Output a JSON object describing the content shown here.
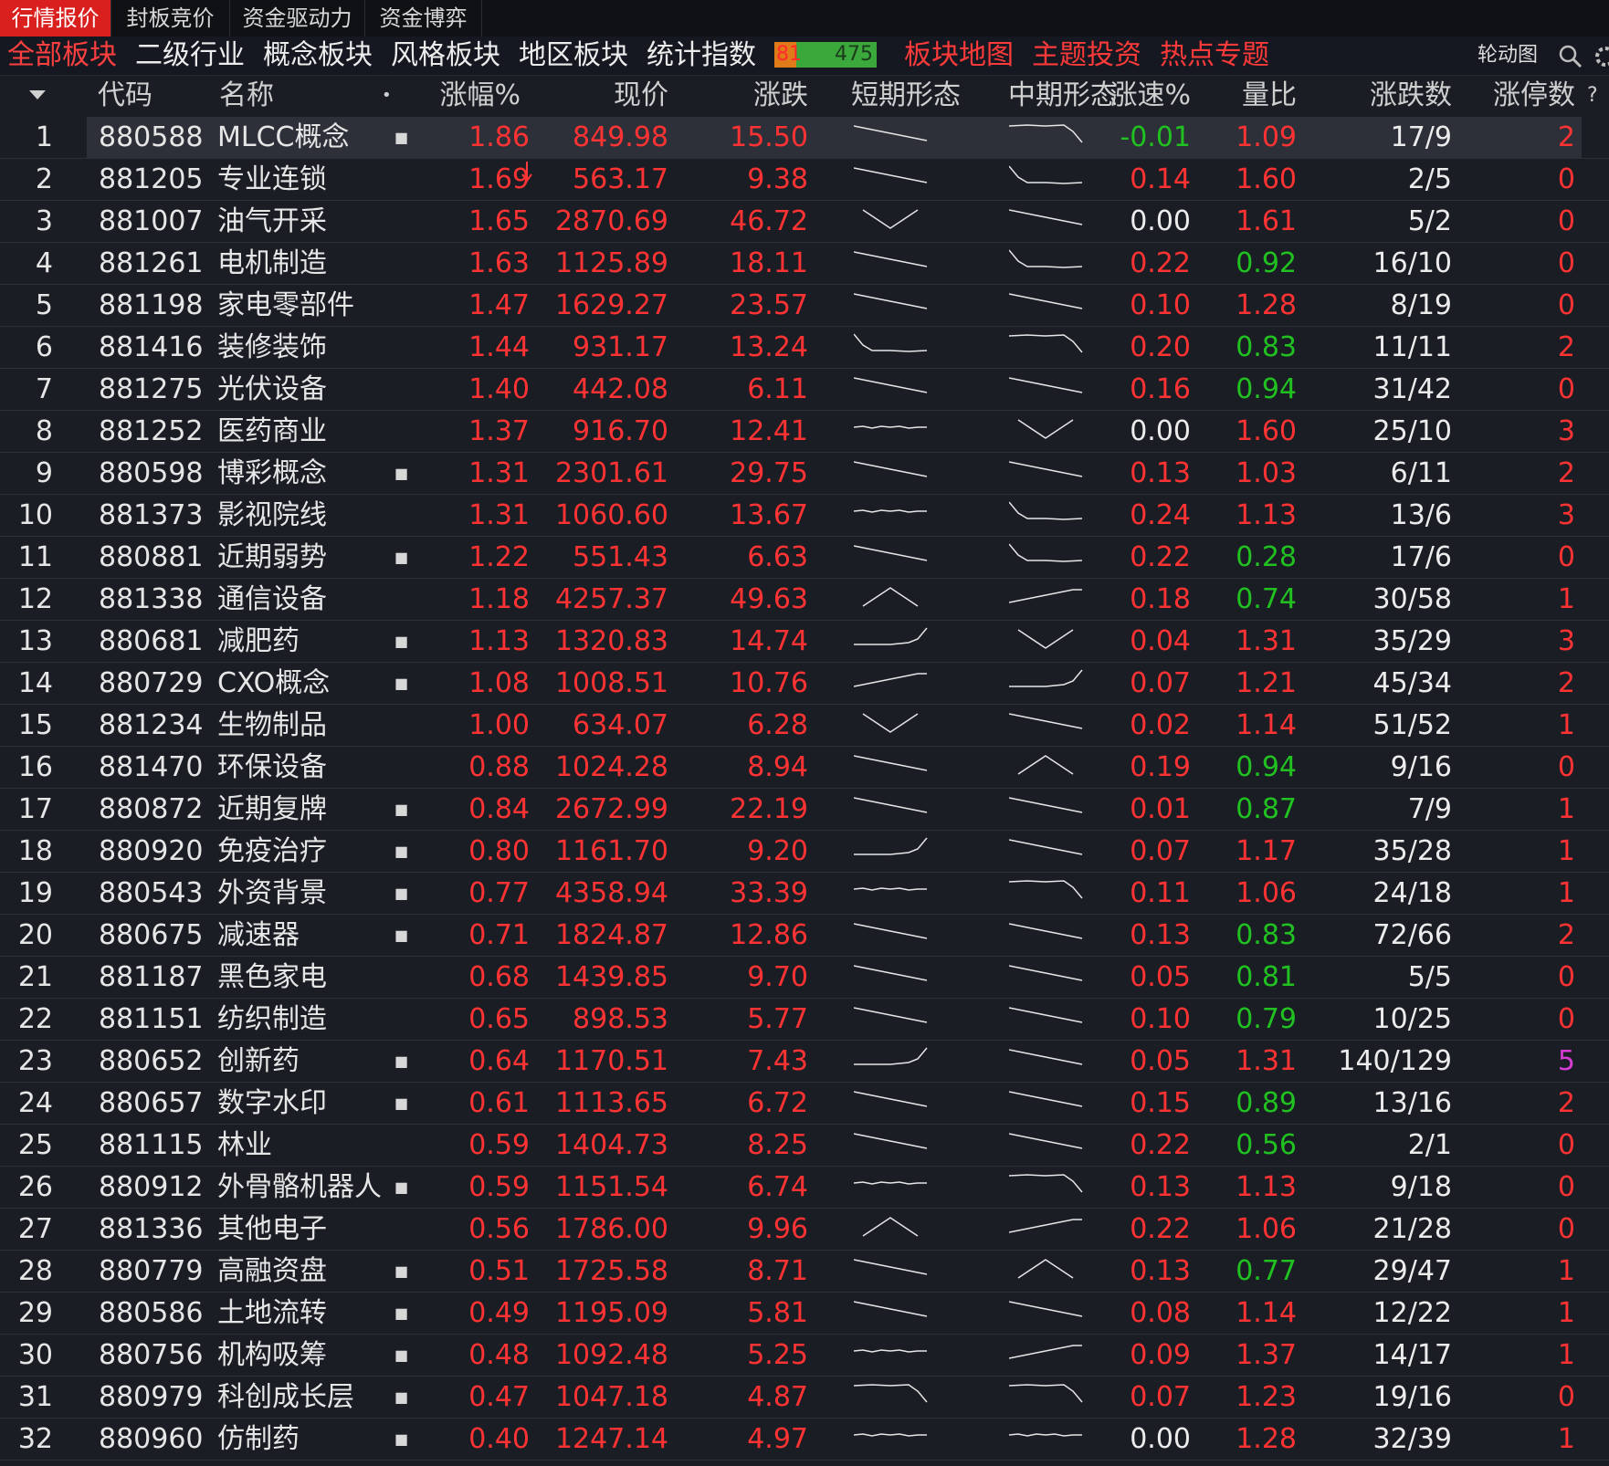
{
  "top_tabs": [
    "行情报价",
    "封板竞价",
    "资金驱动力",
    "资金博弈"
  ],
  "categories": [
    "全部板块",
    "二级行业",
    "概念板块",
    "风格板块",
    "地区板块",
    "统计指数"
  ],
  "ratio": {
    "up": "81",
    "down": "475"
  },
  "feature_links": [
    "板块地图",
    "主题投资",
    "热点专题"
  ],
  "rotation_label": "轮动图",
  "help_label": "?",
  "columns": {
    "code": "代码",
    "name": "名称",
    "dot": "•",
    "change_pct": "涨幅%",
    "price": "现价",
    "change": "涨跌",
    "short": "短期形态",
    "mid": "中期形态",
    "speed": "涨速%",
    "vol_ratio": "量比",
    "updown": "涨跌数",
    "limit_up": "涨停数"
  },
  "colors": {
    "red": "#ff3333",
    "green": "#21c121",
    "white": "#ececec",
    "purple": "#d63bd6",
    "active_tab": "#d9201e"
  },
  "rows": [
    {
      "idx": "1",
      "code": "880588",
      "name": "MLCC概念",
      "dot": true,
      "pct": "1.86",
      "price": "849.98",
      "chg": "15.50",
      "short": "down",
      "mid": "flatdrop",
      "speed": "-0.01",
      "speed_c": "green",
      "vr": "1.09",
      "vr_c": "red",
      "ud": "17/9",
      "lu": "2",
      "lu_c": "red"
    },
    {
      "idx": "2",
      "code": "881205",
      "name": "专业连锁",
      "dot": false,
      "pct": "1.69",
      "price": "563.17",
      "chg": "9.38",
      "short": "down",
      "mid": "dropflat",
      "speed": "0.14",
      "speed_c": "red",
      "vr": "1.60",
      "vr_c": "red",
      "ud": "2/5",
      "lu": "0",
      "lu_c": "red"
    },
    {
      "idx": "3",
      "code": "881007",
      "name": "油气开采",
      "dot": false,
      "pct": "1.65",
      "price": "2870.69",
      "chg": "46.72",
      "short": "v",
      "mid": "down",
      "speed": "0.00",
      "speed_c": "white",
      "vr": "1.61",
      "vr_c": "red",
      "ud": "5/2",
      "lu": "0",
      "lu_c": "red"
    },
    {
      "idx": "4",
      "code": "881261",
      "name": "电机制造",
      "dot": false,
      "pct": "1.63",
      "price": "1125.89",
      "chg": "18.11",
      "short": "down",
      "mid": "dropflat",
      "speed": "0.22",
      "speed_c": "red",
      "vr": "0.92",
      "vr_c": "green",
      "ud": "16/10",
      "lu": "0",
      "lu_c": "red"
    },
    {
      "idx": "5",
      "code": "881198",
      "name": "家电零部件",
      "dot": false,
      "pct": "1.47",
      "price": "1629.27",
      "chg": "23.57",
      "short": "down",
      "mid": "down",
      "speed": "0.10",
      "speed_c": "red",
      "vr": "1.28",
      "vr_c": "red",
      "ud": "8/19",
      "lu": "0",
      "lu_c": "red"
    },
    {
      "idx": "6",
      "code": "881416",
      "name": "装修装饰",
      "dot": false,
      "pct": "1.44",
      "price": "931.17",
      "chg": "13.24",
      "short": "dropflat",
      "mid": "flatdrop",
      "speed": "0.20",
      "speed_c": "red",
      "vr": "0.83",
      "vr_c": "green",
      "ud": "11/11",
      "lu": "2",
      "lu_c": "red"
    },
    {
      "idx": "7",
      "code": "881275",
      "name": "光伏设备",
      "dot": false,
      "pct": "1.40",
      "price": "442.08",
      "chg": "6.11",
      "short": "down",
      "mid": "down",
      "speed": "0.16",
      "speed_c": "red",
      "vr": "0.94",
      "vr_c": "green",
      "ud": "31/42",
      "lu": "0",
      "lu_c": "red"
    },
    {
      "idx": "8",
      "code": "881252",
      "name": "医药商业",
      "dot": false,
      "pct": "1.37",
      "price": "916.70",
      "chg": "12.41",
      "short": "flat",
      "mid": "v",
      "speed": "0.00",
      "speed_c": "white",
      "vr": "1.60",
      "vr_c": "red",
      "ud": "25/10",
      "lu": "3",
      "lu_c": "red"
    },
    {
      "idx": "9",
      "code": "880598",
      "name": "博彩概念",
      "dot": true,
      "pct": "1.31",
      "price": "2301.61",
      "chg": "29.75",
      "short": "down",
      "mid": "down",
      "speed": "0.13",
      "speed_c": "red",
      "vr": "1.03",
      "vr_c": "red",
      "ud": "6/11",
      "lu": "2",
      "lu_c": "red"
    },
    {
      "idx": "10",
      "code": "881373",
      "name": "影视院线",
      "dot": false,
      "pct": "1.31",
      "price": "1060.60",
      "chg": "13.67",
      "short": "flat",
      "mid": "dropflat",
      "speed": "0.24",
      "speed_c": "red",
      "vr": "1.13",
      "vr_c": "red",
      "ud": "13/6",
      "lu": "3",
      "lu_c": "red"
    },
    {
      "idx": "11",
      "code": "880881",
      "name": "近期弱势",
      "dot": true,
      "pct": "1.22",
      "price": "551.43",
      "chg": "6.63",
      "short": "down",
      "mid": "dropflat",
      "speed": "0.22",
      "speed_c": "red",
      "vr": "0.28",
      "vr_c": "green",
      "ud": "17/6",
      "lu": "0",
      "lu_c": "red"
    },
    {
      "idx": "12",
      "code": "881338",
      "name": "通信设备",
      "dot": false,
      "pct": "1.18",
      "price": "4257.37",
      "chg": "49.63",
      "short": "peak",
      "mid": "up",
      "speed": "0.18",
      "speed_c": "red",
      "vr": "0.74",
      "vr_c": "green",
      "ud": "30/58",
      "lu": "1",
      "lu_c": "red"
    },
    {
      "idx": "13",
      "code": "880681",
      "name": "减肥药",
      "dot": true,
      "pct": "1.13",
      "price": "1320.83",
      "chg": "14.74",
      "short": "flatrise",
      "mid": "v",
      "speed": "0.04",
      "speed_c": "red",
      "vr": "1.31",
      "vr_c": "red",
      "ud": "35/29",
      "lu": "3",
      "lu_c": "red"
    },
    {
      "idx": "14",
      "code": "880729",
      "name": "CXO概念",
      "dot": true,
      "pct": "1.08",
      "price": "1008.51",
      "chg": "10.76",
      "short": "up",
      "mid": "flatrise",
      "speed": "0.07",
      "speed_c": "red",
      "vr": "1.21",
      "vr_c": "red",
      "ud": "45/34",
      "lu": "2",
      "lu_c": "red"
    },
    {
      "idx": "15",
      "code": "881234",
      "name": "生物制品",
      "dot": false,
      "pct": "1.00",
      "price": "634.07",
      "chg": "6.28",
      "short": "v",
      "mid": "down",
      "speed": "0.02",
      "speed_c": "red",
      "vr": "1.14",
      "vr_c": "red",
      "ud": "51/52",
      "lu": "1",
      "lu_c": "red"
    },
    {
      "idx": "16",
      "code": "881470",
      "name": "环保设备",
      "dot": false,
      "pct": "0.88",
      "price": "1024.28",
      "chg": "8.94",
      "short": "down",
      "mid": "peak",
      "speed": "0.19",
      "speed_c": "red",
      "vr": "0.94",
      "vr_c": "green",
      "ud": "9/16",
      "lu": "0",
      "lu_c": "red"
    },
    {
      "idx": "17",
      "code": "880872",
      "name": "近期复牌",
      "dot": true,
      "pct": "0.84",
      "price": "2672.99",
      "chg": "22.19",
      "short": "down",
      "mid": "down",
      "speed": "0.01",
      "speed_c": "red",
      "vr": "0.87",
      "vr_c": "green",
      "ud": "7/9",
      "lu": "1",
      "lu_c": "red"
    },
    {
      "idx": "18",
      "code": "880920",
      "name": "免疫治疗",
      "dot": true,
      "pct": "0.80",
      "price": "1161.70",
      "chg": "9.20",
      "short": "flatrise",
      "mid": "down",
      "speed": "0.07",
      "speed_c": "red",
      "vr": "1.17",
      "vr_c": "red",
      "ud": "35/28",
      "lu": "1",
      "lu_c": "red"
    },
    {
      "idx": "19",
      "code": "880543",
      "name": "外资背景",
      "dot": true,
      "pct": "0.77",
      "price": "4358.94",
      "chg": "33.39",
      "short": "flat",
      "mid": "flatdrop",
      "speed": "0.11",
      "speed_c": "red",
      "vr": "1.06",
      "vr_c": "red",
      "ud": "24/18",
      "lu": "1",
      "lu_c": "red"
    },
    {
      "idx": "20",
      "code": "880675",
      "name": "减速器",
      "dot": true,
      "pct": "0.71",
      "price": "1824.87",
      "chg": "12.86",
      "short": "down",
      "mid": "down",
      "speed": "0.13",
      "speed_c": "red",
      "vr": "0.83",
      "vr_c": "green",
      "ud": "72/66",
      "lu": "2",
      "lu_c": "red"
    },
    {
      "idx": "21",
      "code": "881187",
      "name": "黑色家电",
      "dot": false,
      "pct": "0.68",
      "price": "1439.85",
      "chg": "9.70",
      "short": "down",
      "mid": "down",
      "speed": "0.05",
      "speed_c": "red",
      "vr": "0.81",
      "vr_c": "green",
      "ud": "5/5",
      "lu": "0",
      "lu_c": "red"
    },
    {
      "idx": "22",
      "code": "881151",
      "name": "纺织制造",
      "dot": false,
      "pct": "0.65",
      "price": "898.53",
      "chg": "5.77",
      "short": "down",
      "mid": "down",
      "speed": "0.10",
      "speed_c": "red",
      "vr": "0.79",
      "vr_c": "green",
      "ud": "10/25",
      "lu": "0",
      "lu_c": "red"
    },
    {
      "idx": "23",
      "code": "880652",
      "name": "创新药",
      "dot": true,
      "pct": "0.64",
      "price": "1170.51",
      "chg": "7.43",
      "short": "flatrise",
      "mid": "down",
      "speed": "0.05",
      "speed_c": "red",
      "vr": "1.31",
      "vr_c": "red",
      "ud": "140/129",
      "lu": "5",
      "lu_c": "purple"
    },
    {
      "idx": "24",
      "code": "880657",
      "name": "数字水印",
      "dot": true,
      "pct": "0.61",
      "price": "1113.65",
      "chg": "6.72",
      "short": "down",
      "mid": "down",
      "speed": "0.15",
      "speed_c": "red",
      "vr": "0.89",
      "vr_c": "green",
      "ud": "13/16",
      "lu": "2",
      "lu_c": "red"
    },
    {
      "idx": "25",
      "code": "881115",
      "name": "林业",
      "dot": false,
      "pct": "0.59",
      "price": "1404.73",
      "chg": "8.25",
      "short": "down",
      "mid": "down",
      "speed": "0.22",
      "speed_c": "red",
      "vr": "0.56",
      "vr_c": "green",
      "ud": "2/1",
      "lu": "0",
      "lu_c": "red"
    },
    {
      "idx": "26",
      "code": "880912",
      "name": "外骨骼机器人",
      "dot": true,
      "pct": "0.59",
      "price": "1151.54",
      "chg": "6.74",
      "short": "flat",
      "mid": "flatdrop",
      "speed": "0.13",
      "speed_c": "red",
      "vr": "1.13",
      "vr_c": "red",
      "ud": "9/18",
      "lu": "0",
      "lu_c": "red"
    },
    {
      "idx": "27",
      "code": "881336",
      "name": "其他电子",
      "dot": false,
      "pct": "0.56",
      "price": "1786.00",
      "chg": "9.96",
      "short": "peak",
      "mid": "up",
      "speed": "0.22",
      "speed_c": "red",
      "vr": "1.06",
      "vr_c": "red",
      "ud": "21/28",
      "lu": "0",
      "lu_c": "red"
    },
    {
      "idx": "28",
      "code": "880779",
      "name": "高融资盘",
      "dot": true,
      "pct": "0.51",
      "price": "1725.58",
      "chg": "8.71",
      "short": "down",
      "mid": "peak",
      "speed": "0.13",
      "speed_c": "red",
      "vr": "0.77",
      "vr_c": "green",
      "ud": "29/47",
      "lu": "1",
      "lu_c": "red"
    },
    {
      "idx": "29",
      "code": "880586",
      "name": "土地流转",
      "dot": true,
      "pct": "0.49",
      "price": "1195.09",
      "chg": "5.81",
      "short": "down",
      "mid": "down",
      "speed": "0.08",
      "speed_c": "red",
      "vr": "1.14",
      "vr_c": "red",
      "ud": "12/22",
      "lu": "1",
      "lu_c": "red"
    },
    {
      "idx": "30",
      "code": "880756",
      "name": "机构吸筹",
      "dot": true,
      "pct": "0.48",
      "price": "1092.48",
      "chg": "5.25",
      "short": "flat",
      "mid": "up",
      "speed": "0.09",
      "speed_c": "red",
      "vr": "1.37",
      "vr_c": "red",
      "ud": "14/17",
      "lu": "1",
      "lu_c": "red"
    },
    {
      "idx": "31",
      "code": "880979",
      "name": "科创成长层",
      "dot": true,
      "pct": "0.47",
      "price": "1047.18",
      "chg": "4.87",
      "short": "flatdrop",
      "mid": "flatdrop",
      "speed": "0.07",
      "speed_c": "red",
      "vr": "1.23",
      "vr_c": "red",
      "ud": "19/16",
      "lu": "0",
      "lu_c": "red"
    },
    {
      "idx": "32",
      "code": "880960",
      "name": "仿制药",
      "dot": true,
      "pct": "0.40",
      "price": "1247.14",
      "chg": "4.97",
      "short": "flat",
      "mid": "flat",
      "speed": "0.00",
      "speed_c": "white",
      "vr": "1.28",
      "vr_c": "red",
      "ud": "32/39",
      "lu": "1",
      "lu_c": "red"
    }
  ]
}
